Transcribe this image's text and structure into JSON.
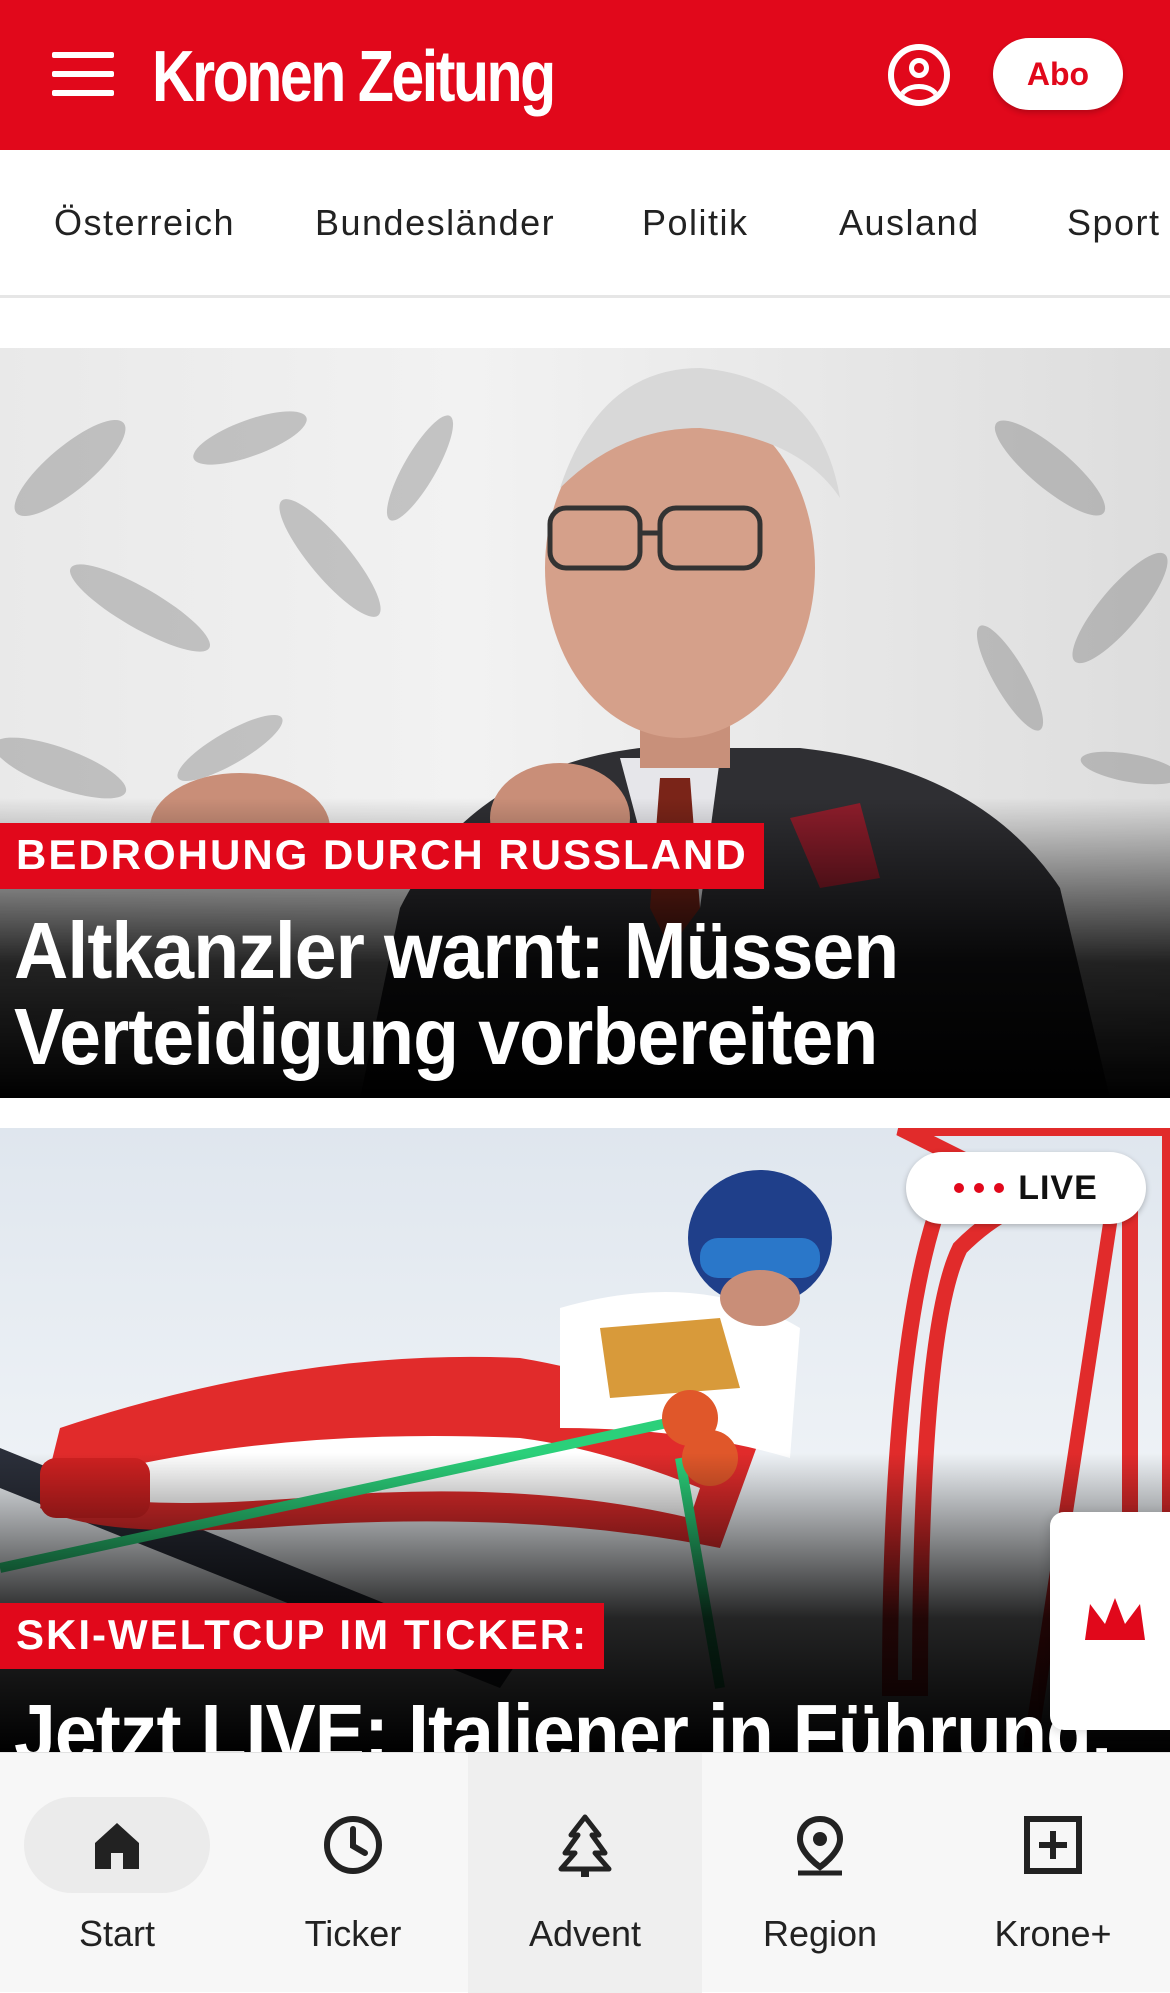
{
  "header": {
    "logo_text": "Kronen Zeitung",
    "abo_label": "Abo"
  },
  "categories": [
    "Österreich",
    "Bundesländer",
    "Politik",
    "Ausland",
    "Sport"
  ],
  "articles": [
    {
      "kicker": "BEDROHUNG DURCH RUSSLAND",
      "headline_line1": "Altkanzler warnt: Müssen",
      "headline_line2": "Verteidigung vorbereiten"
    },
    {
      "live_label": "LIVE",
      "kicker": "SKI-WELTCUP IM TICKER:",
      "headline_line1": "Jetzt LIVE: Italiener in Führung,"
    }
  ],
  "bottom_nav": [
    {
      "label": "Start",
      "icon": "home-icon",
      "active": true
    },
    {
      "label": "Ticker",
      "icon": "clock-icon",
      "active": false
    },
    {
      "label": "Advent",
      "icon": "tree-icon",
      "active": false
    },
    {
      "label": "Region",
      "icon": "location-pin-icon",
      "active": false
    },
    {
      "label": "Krone+",
      "icon": "plus-box-icon",
      "active": false
    }
  ],
  "colors": {
    "brand_red": "#e1081b",
    "white": "#ffffff",
    "nav_background": "#f7f7f7"
  }
}
